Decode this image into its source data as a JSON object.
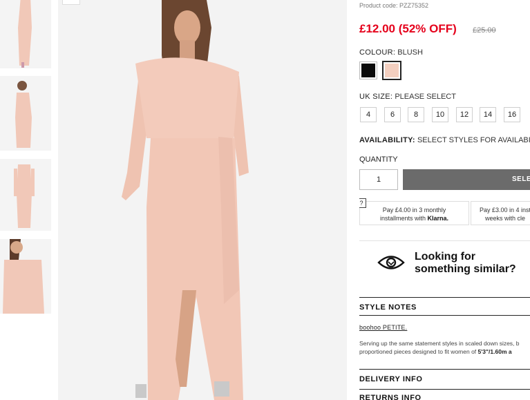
{
  "product": {
    "code": "Product code: PZZ75352",
    "price": "£12.00 (52% OFF)",
    "old_price": "£25.00"
  },
  "colour": {
    "label": "COLOUR:",
    "value": "BLUSH",
    "swatches": [
      {
        "name": "Black",
        "color": "#0a0a0a"
      },
      {
        "name": "Blush",
        "color": "#f3cfc0"
      }
    ]
  },
  "size": {
    "label": "UK SIZE:",
    "value": "PLEASE SELECT",
    "options": [
      "4",
      "6",
      "8",
      "10",
      "12",
      "14",
      "16"
    ]
  },
  "availability": {
    "label": "AVAILABILITY:",
    "value": "SELECT STYLES FOR AVAILABILITY"
  },
  "quantity": {
    "label": "QUANTITY",
    "value": "1"
  },
  "select_button": "SELECT",
  "klarna": {
    "help": "?",
    "line1_a": "Pay £4.00 in 3 monthly",
    "line1_b": "installments with",
    "brand1": "Klarna.",
    "line2_a": "Pay £3.00 in 4 inst",
    "line2_b": "weeks with cle"
  },
  "similar": {
    "line1": "Looking for",
    "line2": "something similar?"
  },
  "style_notes": {
    "heading": "STYLE NOTES",
    "brand": "boohoo PETITE.",
    "desc_line1": "Serving up the same statement styles in scaled down sizes, b",
    "desc_line2_a": "proportioned pieces designed to fit women of ",
    "desc_line2_b": "5'3\"/1.60m a"
  },
  "delivery": "DELIVERY INFO",
  "returns": "RETURNS INFO",
  "colors": {
    "sale_red": "#e5001b",
    "button_grey": "#6b6b6b",
    "dress": "#f3cfc0"
  }
}
